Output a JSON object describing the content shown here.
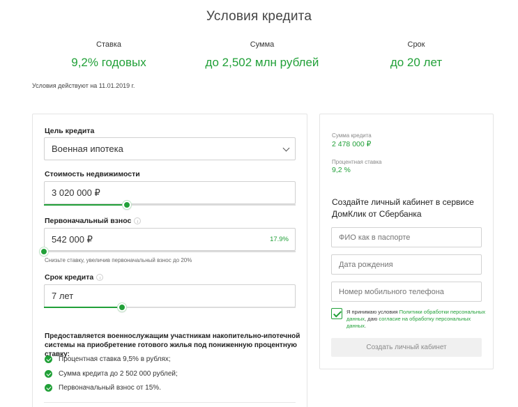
{
  "header": {
    "title": "Условия кредита",
    "stats": [
      {
        "label": "Ставка",
        "value": "9,2% годовых"
      },
      {
        "label": "Сумма",
        "value": "до 2,502 млн рублей"
      },
      {
        "label": "Срок",
        "value": "до 20 лет"
      }
    ],
    "conditions_date": "Условия действуют на 11.01.2019 г."
  },
  "calculator": {
    "purpose": {
      "label": "Цель кредита",
      "value": "Военная ипотека"
    },
    "property_cost": {
      "label": "Стоимость недвижимости",
      "value": "3 020 000 ₽",
      "slider_fraction": 0.33
    },
    "down_payment": {
      "label": "Первоначальный взнос",
      "value": "542 000 ₽",
      "percent": "17.9%",
      "slider_fraction": 0.0,
      "hint": "Снизьте ставку, увеличив первоначальный взнос до 20%"
    },
    "term": {
      "label": "Срок кредита",
      "value": "7 лет",
      "slider_fraction": 0.31
    },
    "benefits": {
      "heading": "Предоставляется военнослужащим участникам накопительно-ипотечной системы на приобретение готового жилья под пониженную процентную ставку:",
      "items": [
        "Процентная ставка 9,5% в рублях;",
        "Сумма кредита до 2 502 000 рублей;",
        "Первоначальный взнос от 15%."
      ]
    }
  },
  "summary": {
    "loan_amount_label": "Сумма кредита",
    "loan_amount": "2 478 000 ₽",
    "rate_label": "Процентная ставка",
    "rate": "9,2 %"
  },
  "registration": {
    "heading": "Создайте личный кабинет в сервисе ДомКлик от Сбербанка",
    "fio_placeholder": "ФИО как в паспорте",
    "birthdate_placeholder": "Дата рождения",
    "phone_placeholder": "Номер мобильного телефона",
    "consent_prefix": "Я принимаю условия ",
    "consent_link1": "Политики обработки персональных данных",
    "consent_middle": ", даю ",
    "consent_link2": "согласие на обработку персональных данных",
    "consent_suffix": ".",
    "submit_label": "Создать личный кабинет"
  },
  "colors": {
    "accent": "#21a038"
  }
}
